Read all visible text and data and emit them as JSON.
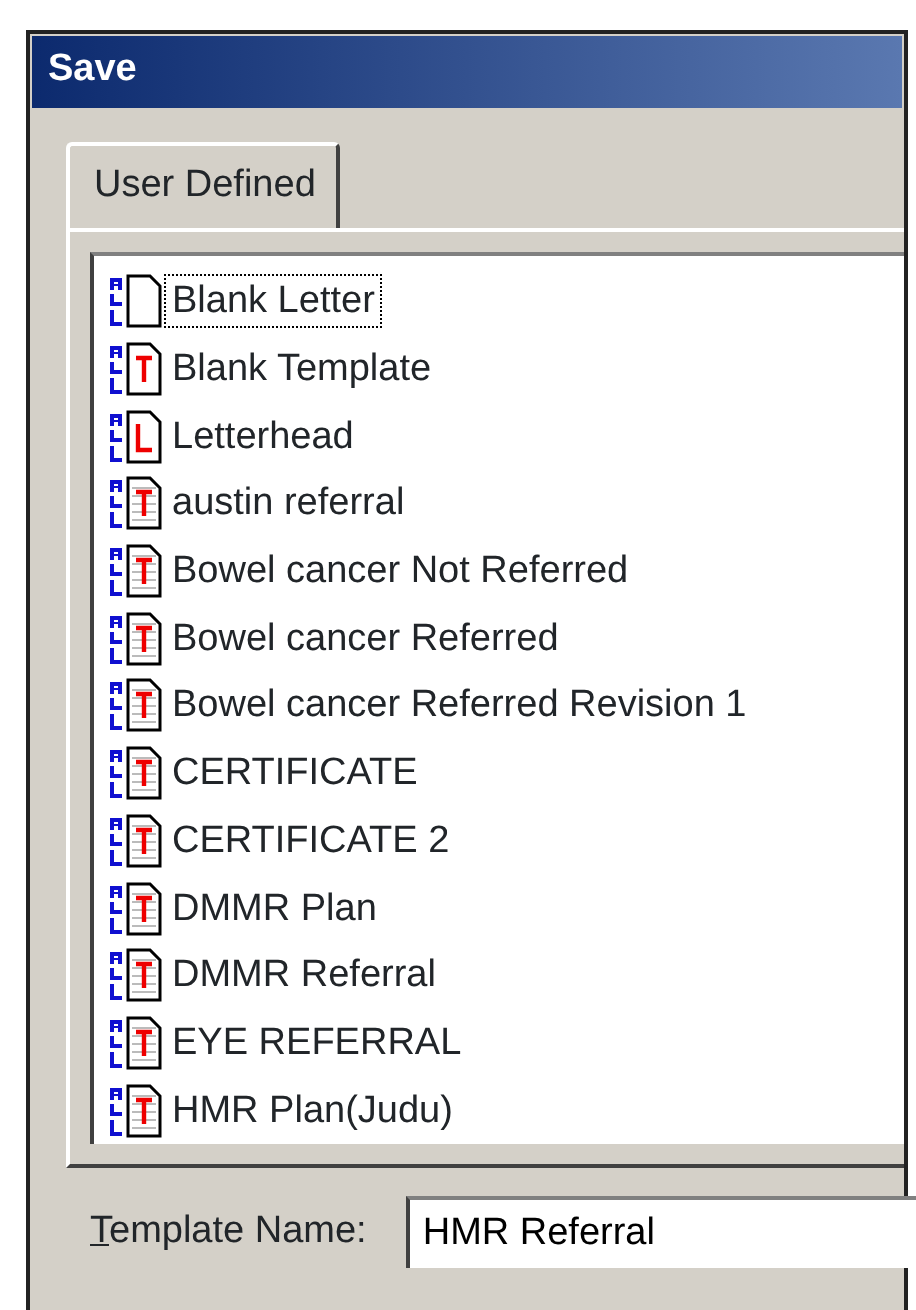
{
  "window": {
    "title": "Save"
  },
  "tabs": [
    {
      "label": "User Defined",
      "selected": true
    }
  ],
  "templates": [
    {
      "name": "Blank Letter",
      "kind": "blank",
      "focused": true
    },
    {
      "name": "Blank Template",
      "kind": "template",
      "focused": false
    },
    {
      "name": "Letterhead",
      "kind": "letterhead",
      "focused": false
    },
    {
      "name": "austin referral",
      "kind": "lined",
      "focused": false
    },
    {
      "name": "Bowel cancer Not Referred",
      "kind": "lined",
      "focused": false
    },
    {
      "name": "Bowel cancer Referred",
      "kind": "lined",
      "focused": false
    },
    {
      "name": "Bowel cancer Referred Revision 1",
      "kind": "lined",
      "focused": false
    },
    {
      "name": "CERTIFICATE",
      "kind": "lined",
      "focused": false
    },
    {
      "name": "CERTIFICATE 2",
      "kind": "lined",
      "focused": false
    },
    {
      "name": "DMMR Plan",
      "kind": "lined",
      "focused": false
    },
    {
      "name": "DMMR Referral",
      "kind": "lined",
      "focused": false
    },
    {
      "name": "EYE REFERRAL",
      "kind": "lined",
      "focused": false
    },
    {
      "name": "HMR Plan(Judu)",
      "kind": "lined",
      "focused": false
    }
  ],
  "template_name": {
    "label": "Template Name:",
    "access_key_underlined": true,
    "value": "HMR Referral"
  }
}
